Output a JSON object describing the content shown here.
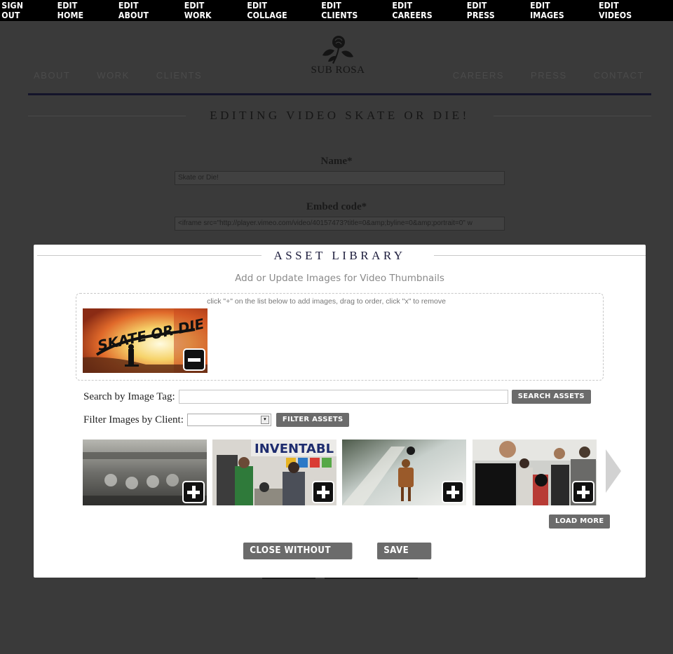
{
  "admin_bar": {
    "items": [
      "SIGN OUT",
      "EDIT HOME",
      "EDIT ABOUT",
      "EDIT WORK",
      "EDIT COLLAGE",
      "EDIT CLIENTS",
      "EDIT CAREERS",
      "EDIT PRESS",
      "EDIT IMAGES",
      "EDIT VIDEOS"
    ]
  },
  "site": {
    "logo_text": "SUB ROSA",
    "nav_left": [
      "ABOUT",
      "WORK",
      "CLIENTS"
    ],
    "nav_right": [
      "CAREERS",
      "PRESS",
      "CONTACT"
    ]
  },
  "form": {
    "title": "EDITING VIDEO SKATE OR DIE!",
    "name_label": "Name*",
    "name_value": "Skate or Die!",
    "embed_label": "Embed code*",
    "embed_value": "<iframe src=\"http://player.vimeo.com/video/40157473?title=0&amp;byline=0&amp;portrait=0\" w"
  },
  "modal": {
    "title": "ASSET LIBRARY",
    "subtitle": "Add or Update Images for Video Thumbnails",
    "dropzone_hint": "click \"+\" on the list below to add images, drag to order, click \"x\" to remove",
    "selected_image_text": "SKATE OR DIE",
    "search_label": "Search by Image Tag:",
    "search_value": "",
    "search_button": "SEARCH ASSETS",
    "filter_label": "Filter Images by Client:",
    "filter_value": "",
    "filter_button": "FILTER ASSETS",
    "library_banner_text": "INVENTABL",
    "load_more_button": "LOAD MORE",
    "close_button": "CLOSE WITHOUT SAVING",
    "save_button": "SAVE THIS"
  },
  "colors": {
    "admin_bar_bg": "#000000",
    "overlay_bg": "#3a3a3a",
    "button_bg": "#6b6b6b",
    "modal_title": "#1b1b3b"
  },
  "icons": [
    "rose-logo-icon",
    "remove-icon",
    "add-icon",
    "select-arrow-icon",
    "next-arrow-icon"
  ]
}
